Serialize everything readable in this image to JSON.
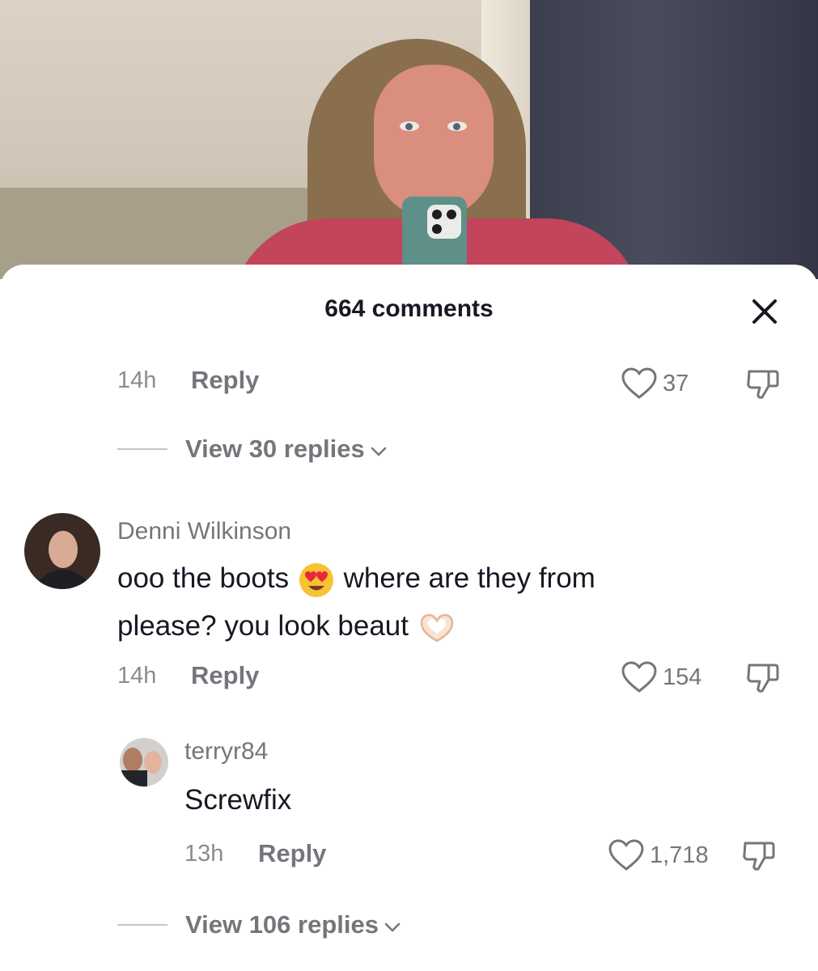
{
  "sheet": {
    "title": "664 comments"
  },
  "icons": {
    "close": "close-icon",
    "like": "heart-outline-icon",
    "dislike": "thumbs-down-icon",
    "chevron": "chevron-down-icon",
    "heart_eyes": "heart-eyes-emoji",
    "heart_hands": "heart-hands-emoji"
  },
  "comments": [
    {
      "time": "14h",
      "reply_label": "Reply",
      "likes": "37",
      "view_replies": "View 30 replies"
    },
    {
      "username": "Denni Wilkinson",
      "text_part1": "ooo the boots",
      "text_part2": "where are they from",
      "text_part3": "please? you look beaut",
      "time": "14h",
      "reply_label": "Reply",
      "likes": "154",
      "replies": [
        {
          "username": "terryr84",
          "text": "Screwfix",
          "time": "13h",
          "reply_label": "Reply",
          "likes": "1,718"
        }
      ],
      "view_replies": "View 106 replies"
    }
  ],
  "colors": {
    "text_primary": "#161823",
    "text_secondary": "#75767c",
    "text_tertiary": "#8a8b91"
  }
}
